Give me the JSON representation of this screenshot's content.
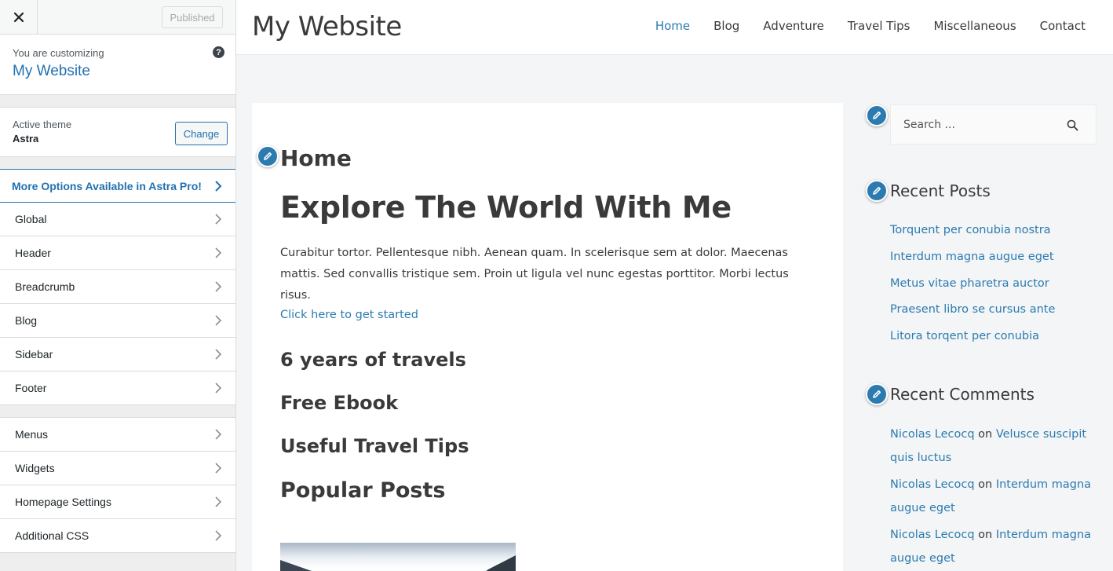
{
  "customizer": {
    "published_label": "Published",
    "customizing_label": "You are customizing",
    "site_name": "My Website",
    "help_glyph": "?",
    "active_theme_label": "Active theme",
    "theme_name": "Astra",
    "change_label": "Change",
    "pro_label": "More Options Available in Astra Pro!",
    "sections": [
      "Global",
      "Header",
      "Breadcrumb",
      "Blog",
      "Sidebar",
      "Footer"
    ],
    "sections2": [
      "Menus",
      "Widgets",
      "Homepage Settings",
      "Additional CSS"
    ]
  },
  "preview": {
    "site_title": "My Website",
    "nav": [
      "Home",
      "Blog",
      "Adventure",
      "Travel Tips",
      "Miscellaneous",
      "Contact"
    ],
    "active_nav": "Home",
    "page_title": "Home",
    "hero": "Explore The World With Me",
    "paragraph": "Curabitur tortor. Pellentesque nibh. Aenean quam. In scelerisque sem at dolor. Maecenas mattis. Sed convallis tristique sem. Proin ut ligula vel nunc egestas porttitor. Morbi lectus risus.",
    "cta": "Click here to get started",
    "headings": [
      "6 years of travels",
      "Free Ebook",
      "Useful Travel Tips"
    ],
    "popular": "Popular Posts",
    "search_placeholder": "Search ...",
    "recent_posts_title": "Recent Posts",
    "recent_posts": [
      "Torquent per conubia nostra",
      "Interdum magna augue eget",
      "Metus vitae pharetra auctor",
      "Praesent libro se cursus ante",
      "Litora torqent per conubia"
    ],
    "recent_comments_title": "Recent Comments",
    "comments": [
      {
        "author": "Nicolas Lecocq",
        "on": "on",
        "post": "Velusce suscipit quis luctus"
      },
      {
        "author": "Nicolas Lecocq",
        "on": "on",
        "post": "Interdum magna augue eget"
      },
      {
        "author": "Nicolas Lecocq",
        "on": "on",
        "post": "Interdum magna augue eget"
      }
    ]
  },
  "colors": {
    "accent": "#2b7bb0",
    "wp_blue": "#2271b1",
    "text": "#3a3a3a"
  }
}
